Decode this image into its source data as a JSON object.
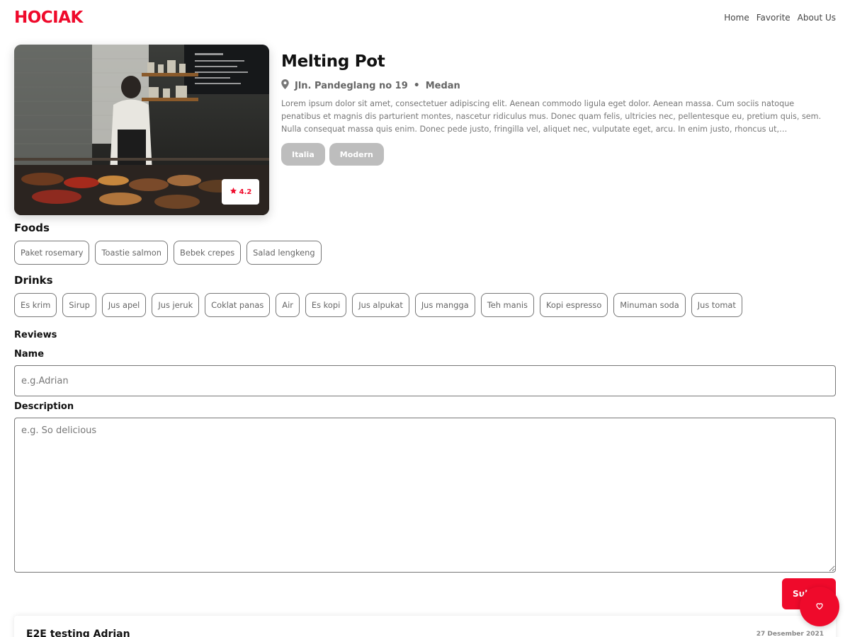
{
  "nav": {
    "logo": "HOCIAK",
    "links": [
      "Home",
      "Favorite",
      "About Us"
    ]
  },
  "restaurant": {
    "name": "Melting Pot",
    "address": "Jln. Pandeglang no 19",
    "city": "Medan",
    "separator": "•",
    "rating": "4.2",
    "description": "Lorem ipsum dolor sit amet, consectetuer adipiscing elit. Aenean commodo ligula eget dolor. Aenean massa. Cum sociis natoque penatibus et magnis dis parturient montes, nascetur ridiculus mus. Donec quam felis, ultricies nec, pellentesque eu, pretium quis, sem. Nulla consequat massa quis enim. Donec pede justo, fringilla vel, aliquet nec, vulputate eget, arcu. In enim justo, rhoncus ut,…",
    "categories": [
      "Italia",
      "Modern"
    ]
  },
  "menus": {
    "foods_title": "Foods",
    "foods": [
      "Paket rosemary",
      "Toastie salmon",
      "Bebek crepes",
      "Salad lengkeng"
    ],
    "drinks_title": "Drinks",
    "drinks": [
      "Es krim",
      "Sirup",
      "Jus apel",
      "Jus jeruk",
      "Coklat panas",
      "Air",
      "Es kopi",
      "Jus alpukat",
      "Jus mangga",
      "Teh manis",
      "Kopi espresso",
      "Minuman soda",
      "Jus tomat"
    ]
  },
  "review_form": {
    "title": "Reviews",
    "name_label": "Name",
    "name_placeholder": "e.g.Adrian",
    "desc_label": "Description",
    "desc_placeholder": "e.g. So delicious",
    "submit_label": "Submit"
  },
  "reviews": [
    {
      "name": "E2E testing Adrian",
      "date": "27 Desember 2021"
    }
  ],
  "colors": {
    "accent": "#ef0a2b",
    "category_bg": "#bdbdbd"
  },
  "icons": {
    "location": "map-pin-icon",
    "rating": "star-icon",
    "fab": "heart-icon"
  }
}
